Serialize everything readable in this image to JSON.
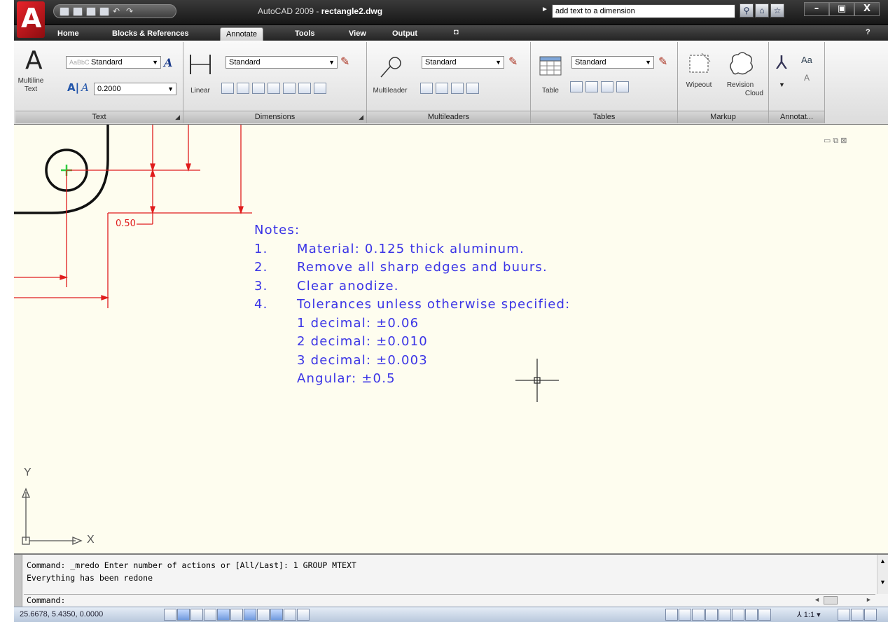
{
  "title_bar": {
    "app_name": "AutoCAD 2009 - ",
    "file_name": "rectangle2.dwg",
    "search_value": "add text to a dimension",
    "minimize": "–",
    "restore": "▣",
    "close": "X"
  },
  "tabs": [
    "Home",
    "Blocks & References",
    "Annotate",
    "Tools",
    "View",
    "Output"
  ],
  "active_tab": "Annotate",
  "panels": {
    "text": {
      "title": "Text",
      "big_button_line1": "Multiline",
      "big_button_line2": "Text",
      "style_value": "Standard",
      "height_value": "0.2000"
    },
    "dimensions": {
      "title": "Dimensions",
      "style_value": "Standard",
      "linear_label": "Linear"
    },
    "multileaders": {
      "title": "Multileaders",
      "style_value": "Standard",
      "button_label": "Multileader"
    },
    "tables": {
      "title": "Tables",
      "style_value": "Standard",
      "button_label": "Table"
    },
    "markup": {
      "title": "Markup",
      "wipeout_label": "Wipeout",
      "revision_line1": "Revision",
      "revision_line2": "Cloud"
    },
    "annotation": {
      "title": "Annotat..."
    }
  },
  "drawing": {
    "dimension_label": "0.50",
    "notes_title": "Notes:",
    "notes": [
      {
        "num": "1.",
        "text": "Material: 0.125 thick aluminum."
      },
      {
        "num": "2.",
        "text": "Remove all sharp edges and buurs."
      },
      {
        "num": "3.",
        "text": "Clear anodize."
      },
      {
        "num": "4.",
        "text": "Tolerances unless otherwise specified:"
      }
    ],
    "tolerances": [
      "1 decimal: ±0.06",
      "2 decimal: ±0.010",
      "3 decimal: ±0.003",
      "Angular: ±0.5"
    ],
    "ucs_y": "Y",
    "ucs_x": "X",
    "line_color": "#e01d1d",
    "text_color": "#3a34e6",
    "background_color": "#fefdef"
  },
  "command_window": {
    "history_line1": "Command: _mredo Enter number of actions or [All/Last]: 1 GROUP MTEXT",
    "history_line2": "Everything has been redone",
    "prompt": "Command:"
  },
  "status_bar": {
    "coordinates": "25.6678, 5.4350, 0.0000",
    "annotation_scale": "1:1"
  }
}
